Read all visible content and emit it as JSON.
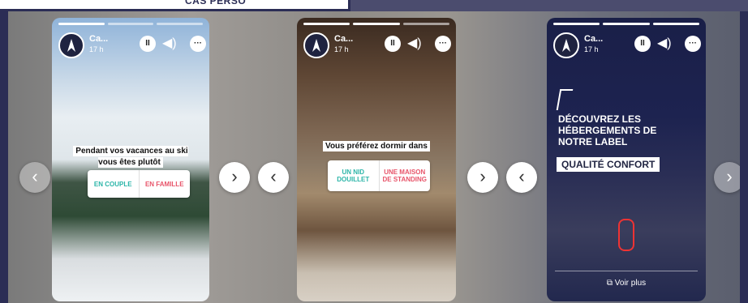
{
  "banner": {
    "text": "CAS PERSO"
  },
  "stories": [
    {
      "account": "Ca...",
      "time": "17 h",
      "question": "Pendant vos vacances au ski vous êtes plutôt",
      "options": [
        "EN COUPLE",
        "EN FAMILLE"
      ],
      "option_colors": [
        "#2bb5a8",
        "#e8556a"
      ]
    },
    {
      "account": "Ca...",
      "time": "17 h",
      "question": "Vous préférez dormir dans",
      "options": [
        "UN NID DOUILLET",
        "UNE MAISON DE STANDING"
      ],
      "option_colors": [
        "#2bb5a8",
        "#e8556a"
      ]
    },
    {
      "account": "Ca...",
      "time": "17 h",
      "headline": "DÉCOUVREZ LES HÉBERGEMENTS DE NOTRE LABEL",
      "label": "QUALITÉ CONFORT",
      "cta": "Voir plus"
    }
  ],
  "icons": {
    "pause": "pause-icon",
    "volume": "volume-icon",
    "more": "more-icon",
    "prev": "chevron-left-icon",
    "next": "chevron-right-icon",
    "external": "external-link-icon"
  }
}
